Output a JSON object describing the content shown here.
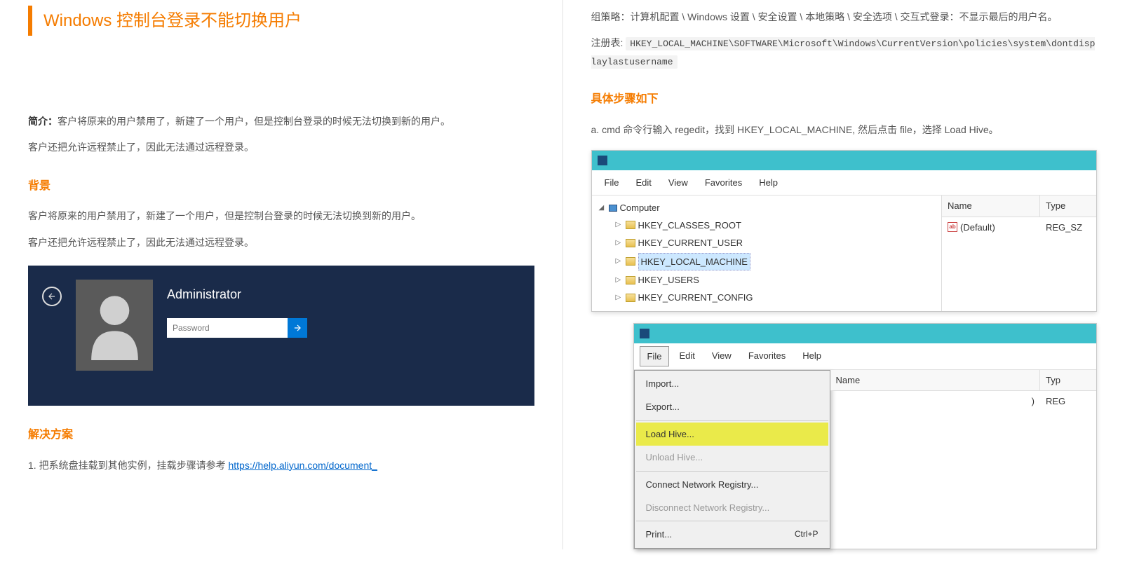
{
  "title": "Windows 控制台登录不能切换用户",
  "intro_label": "简介：",
  "intro_text": "客户将原来的用户禁用了，新建了一个用户，但是控制台登录的时候无法切换到新的用户。",
  "intro_text2": "客户还把允许远程禁止了，因此无法通过远程登录。",
  "section_bg": "背景",
  "bg_p1": "客户将原来的用户禁用了，新建了一个用户，但是控制台登录的时候无法切换到新的用户。",
  "bg_p2": "客户还把允许远程禁止了，因此无法通过远程登录。",
  "login": {
    "username": "Administrator",
    "password_placeholder": "Password"
  },
  "section_solution": "解决方案",
  "sol_item1": "把系统盘挂载到其他实例，挂载步骤请参考 ",
  "sol_link": "https://help.aliyun.com/document_",
  "right": {
    "gp_text": "组策略：计算机配置 \\ Windows 设置 \\ 安全设置 \\ 本地策略 \\ 安全选项 \\ 交互式登录：不显示最后的用户名。",
    "reg_label": "注册表: ",
    "reg_path": "HKEY_LOCAL_MACHINE\\SOFTWARE\\Microsoft\\Windows\\CurrentVersion\\policies\\system\\dontdisplaylastusername",
    "section_steps": "具体步骤如下",
    "step_a": "cmd 命令行输入 regedit，找到 HKEY_LOCAL_MACHINE, 然后点击 file，选择 Load Hive。"
  },
  "regedit": {
    "menu": {
      "file": "File",
      "edit": "Edit",
      "view": "View",
      "favorites": "Favorites",
      "help": "Help"
    },
    "tree": {
      "root": "Computer",
      "k1": "HKEY_CLASSES_ROOT",
      "k2": "HKEY_CURRENT_USER",
      "k3": "HKEY_LOCAL_MACHINE",
      "k4": "HKEY_USERS",
      "k5": "HKEY_CURRENT_CONFIG"
    },
    "values": {
      "col_name": "Name",
      "col_type": "Type",
      "default_name": "(Default)",
      "default_type": "REG_SZ",
      "col_type_short": "Typ",
      "reg_short": "REG"
    },
    "dropdown": {
      "import": "Import...",
      "export": "Export...",
      "load_hive": "Load Hive...",
      "unload_hive": "Unload Hive...",
      "connect": "Connect Network Registry...",
      "disconnect": "Disconnect Network Registry...",
      "print": "Print...",
      "print_shortcut": "Ctrl+P"
    }
  }
}
